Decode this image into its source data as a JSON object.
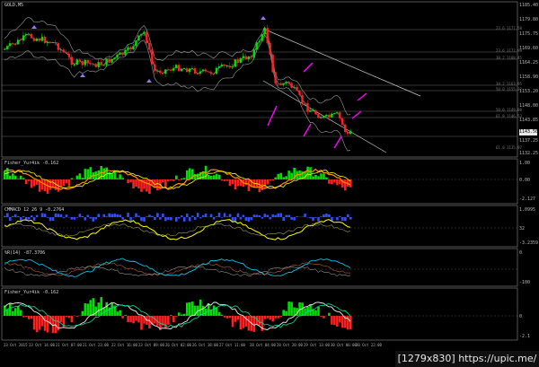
{
  "symbol": "GOLD,M5",
  "price_axis": [
    "1185.40",
    "1179.80",
    "1175.75",
    "1169.60",
    "1164.25",
    "1158.90",
    "1153.20",
    "1148.00",
    "1143.85",
    "1137.25",
    "1132.25"
  ],
  "current_price": "1143.50",
  "levels": [
    {
      "label": "23.6 1177.58"
    },
    {
      "label": "23.6 1172.99"
    },
    {
      "label": "38.2 1168.45"
    },
    {
      "label": "38.2 1163.95"
    },
    {
      "label": "50.0 1155.22"
    },
    {
      "label": "50.0 1149.80"
    },
    {
      "label": "61.8 1146.53"
    },
    {
      "label": "61.8 1135.97"
    }
  ],
  "panels": [
    {
      "label": "Fisher_Yur4ik -0.162",
      "scale": [
        "1.00",
        "0.00",
        "-2.127"
      ]
    },
    {
      "label": "CMMACD 12 26 9 -0.2764",
      "scale": [
        "1.0995",
        "32",
        "-3.2359"
      ]
    },
    {
      "label": "%R(14) -87.3706",
      "scale": [
        "0",
        "-100"
      ]
    },
    {
      "label": "Fisher_Yur4ik -0.162",
      "scale": [
        "0",
        "-2.1"
      ]
    }
  ],
  "time_axis": [
    "23 Oct 2015",
    "23 Oct 14:00",
    "21 Oct 07:00",
    "21 Oct 23:00",
    "22 Oct 16:00",
    "23 Oct 09:00",
    "26 Oct 02:00",
    "26 Oct 18:00",
    "27 Oct 11:00",
    "28 Oct 04:00",
    "28 Oct 20:00",
    "29 Oct 13:00",
    "30 Oct 06:00",
    "30 Oct 22:00"
  ],
  "watermark": "[1279x830] https://upic.me/",
  "colors": {
    "up": "#00e000",
    "down": "#ff2020",
    "bands": "#9aa0a0",
    "arrow": "#ff00ff",
    "signal": "#ffff00",
    "fisher": "#ff9000",
    "wpr": "#00d8ff",
    "macd": "#3050ff"
  }
}
